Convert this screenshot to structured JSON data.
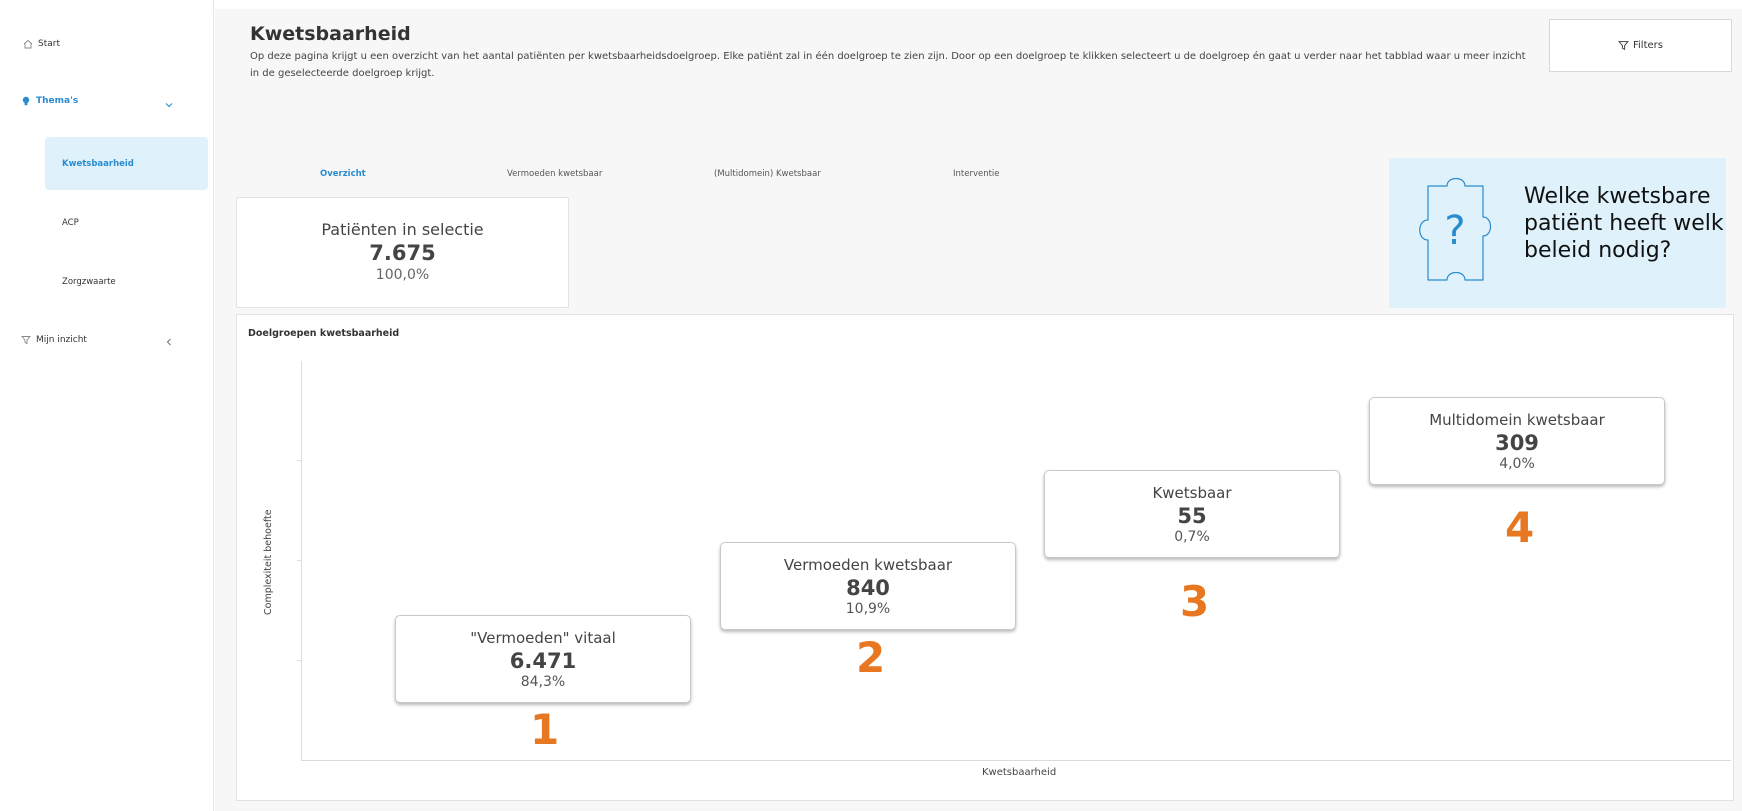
{
  "sidebar": {
    "start": "Start",
    "themas": "Thema's",
    "sub_items": [
      "Kwetsbaarheid",
      "ACP",
      "Zorgzwaarte"
    ],
    "mijn_inzicht": "Mijn inzicht"
  },
  "header": {
    "title": "Kwetsbaarheid",
    "description": "Op deze pagina krijgt u een overzicht van het aantal patiënten per kwetsbaarheidsdoelgroep. Elke patiënt zal in één doelgroep te zien zijn. Door op een doelgroep te klikken selecteert u de doelgroep én gaat u verder naar het tabblad waar u meer inzicht in de geselecteerde doelgroep krijgt.",
    "filters": "Filters"
  },
  "tabs": [
    "Overzicht",
    "Vermoeden kwetsbaar",
    "(Multidomein) Kwetsbaar",
    "Interventie"
  ],
  "kpi": {
    "label": "Patiënten in selectie",
    "value": "7.675",
    "pct": "100,0%"
  },
  "info": {
    "text": "Welke kwetsbare patiënt heeft welk beleid nodig?",
    "icon_symbol": "?"
  },
  "chart": {
    "title": "Doelgroepen kwetsbaarheid",
    "ylabel": "Complexiteit behoefte",
    "xlabel": "Kwetsbaarheid"
  },
  "groups": [
    {
      "label": "\"Vermoeden\" vitaal",
      "value": "6.471",
      "pct": "84,3%",
      "number": "1"
    },
    {
      "label": "Vermoeden kwetsbaar",
      "value": "840",
      "pct": "10,9%",
      "number": "2"
    },
    {
      "label": "Kwetsbaar",
      "value": "55",
      "pct": "0,7%",
      "number": "3"
    },
    {
      "label": "Multidomein kwetsbaar",
      "value": "309",
      "pct": "4,0%",
      "number": "4"
    }
  ],
  "colors": {
    "accent": "#2a8ccf",
    "active_bg": "#dff2fb",
    "number_orange": "#e87722"
  }
}
